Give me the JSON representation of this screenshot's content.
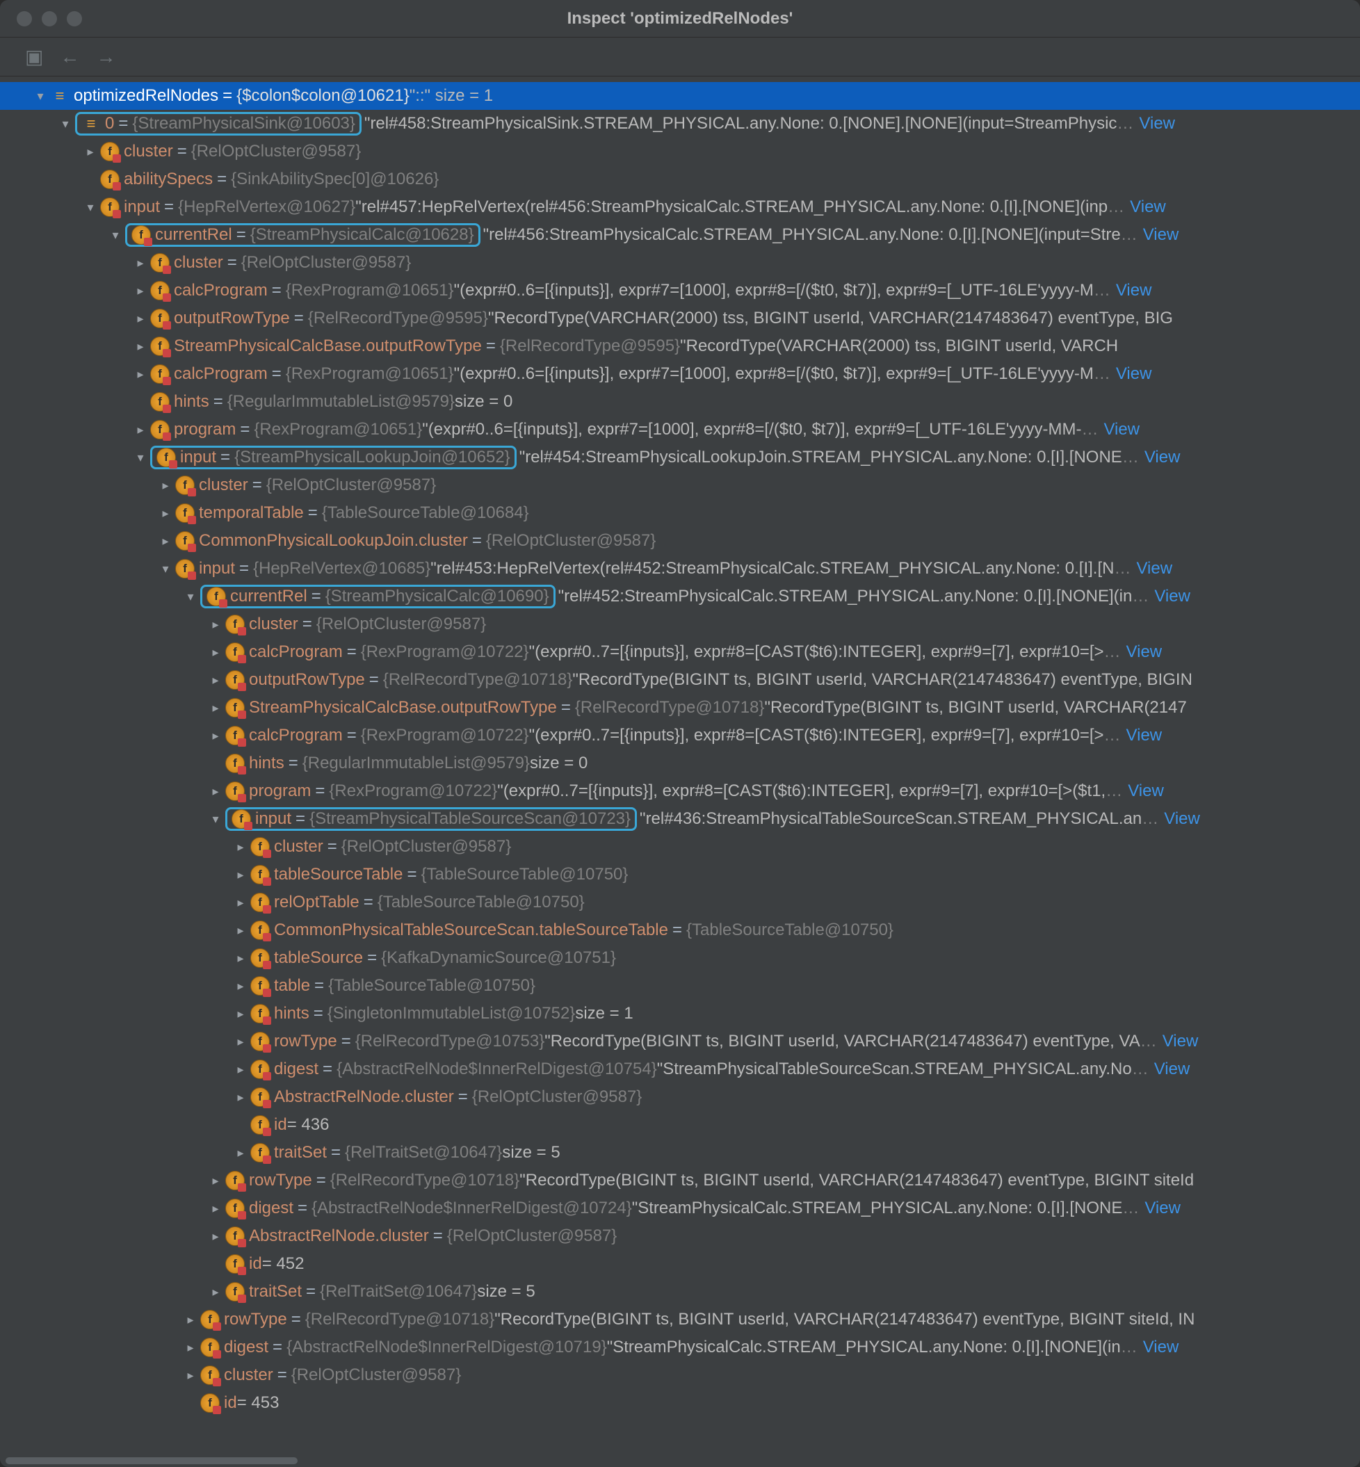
{
  "window": {
    "title": "Inspect 'optimizedRelNodes'"
  },
  "colors": {
    "highlight_box": "#3aa7d6",
    "selection": "#0d5dbb",
    "field_name": "#cf8e6d",
    "ref": "#808080",
    "link": "#3d94e8"
  },
  "actions": {
    "view": "View"
  },
  "tree": [
    {
      "depth": 0,
      "arrow": "down",
      "icon": "list",
      "sel": true,
      "name": "optimizedRelNodes",
      "ref": "{$colon$colon@10621}",
      "tail": " \"::\"  size = 1"
    },
    {
      "depth": 1,
      "arrow": "down",
      "icon": "list",
      "box": true,
      "name": "0",
      "ref": "{StreamPhysicalSink@10603}",
      "str": "\"rel#458:StreamPhysicalSink.STREAM_PHYSICAL.any.None: 0.[NONE].[NONE](input=StreamPhysic",
      "ell": true,
      "view": true
    },
    {
      "depth": 2,
      "arrow": "right",
      "icon": "f",
      "name": "cluster",
      "ref": "{RelOptCluster@9587}"
    },
    {
      "depth": 2,
      "arrow": "none",
      "icon": "f",
      "name": "abilitySpecs",
      "ref": "{SinkAbilitySpec[0]@10626}"
    },
    {
      "depth": 2,
      "arrow": "down",
      "icon": "f",
      "name": "input",
      "ref": "{HepRelVertex@10627}",
      "str": " \"rel#457:HepRelVertex(rel#456:StreamPhysicalCalc.STREAM_PHYSICAL.any.None: 0.[I].[NONE](inp",
      "ell": true,
      "view": true
    },
    {
      "depth": 3,
      "arrow": "down",
      "icon": "f",
      "box": true,
      "name": "currentRel",
      "ref": "{StreamPhysicalCalc@10628}",
      "str": "\"rel#456:StreamPhysicalCalc.STREAM_PHYSICAL.any.None: 0.[I].[NONE](input=Stre",
      "ell": true,
      "view": true
    },
    {
      "depth": 4,
      "arrow": "right",
      "icon": "f",
      "name": "cluster",
      "ref": "{RelOptCluster@9587}"
    },
    {
      "depth": 4,
      "arrow": "right",
      "icon": "f",
      "name": "calcProgram",
      "ref": "{RexProgram@10651}",
      "str": " \"(expr#0..6=[{inputs}], expr#7=[1000], expr#8=[/($t0, $t7)], expr#9=[_UTF-16LE'yyyy-M",
      "ell": true,
      "view": true
    },
    {
      "depth": 4,
      "arrow": "right",
      "icon": "f",
      "name": "outputRowType",
      "ref": "{RelRecordType@9595}",
      "str": " \"RecordType(VARCHAR(2000) tss, BIGINT userId, VARCHAR(2147483647) eventType, BIG"
    },
    {
      "depth": 4,
      "arrow": "right",
      "icon": "f",
      "name": "StreamPhysicalCalcBase.outputRowType",
      "ref": "{RelRecordType@9595}",
      "str": " \"RecordType(VARCHAR(2000) tss, BIGINT userId, VARCH"
    },
    {
      "depth": 4,
      "arrow": "right",
      "icon": "f",
      "name": "calcProgram",
      "ref": "{RexProgram@10651}",
      "str": " \"(expr#0..6=[{inputs}], expr#7=[1000], expr#8=[/($t0, $t7)], expr#9=[_UTF-16LE'yyyy-M",
      "ell": true,
      "view": true
    },
    {
      "depth": 4,
      "arrow": "none",
      "icon": "f",
      "name": "hints",
      "ref": "{RegularImmutableList@9579}",
      "tail": "  size = 0"
    },
    {
      "depth": 4,
      "arrow": "right",
      "icon": "f",
      "name": "program",
      "ref": "{RexProgram@10651}",
      "str": " \"(expr#0..6=[{inputs}], expr#7=[1000], expr#8=[/($t0, $t7)], expr#9=[_UTF-16LE'yyyy-MM-",
      "ell": true,
      "view": true
    },
    {
      "depth": 4,
      "arrow": "down",
      "icon": "f",
      "box": true,
      "name": "input",
      "ref": "{StreamPhysicalLookupJoin@10652}",
      "str": "\"rel#454:StreamPhysicalLookupJoin.STREAM_PHYSICAL.any.None: 0.[I].[NONE",
      "ell": true,
      "view": true
    },
    {
      "depth": 5,
      "arrow": "right",
      "icon": "f",
      "name": "cluster",
      "ref": "{RelOptCluster@9587}"
    },
    {
      "depth": 5,
      "arrow": "right",
      "icon": "f",
      "name": "temporalTable",
      "ref": "{TableSourceTable@10684}"
    },
    {
      "depth": 5,
      "arrow": "right",
      "icon": "f",
      "name": "CommonPhysicalLookupJoin.cluster",
      "ref": "{RelOptCluster@9587}"
    },
    {
      "depth": 5,
      "arrow": "down",
      "icon": "f",
      "name": "input",
      "ref": "{HepRelVertex@10685}",
      "str": " \"rel#453:HepRelVertex(rel#452:StreamPhysicalCalc.STREAM_PHYSICAL.any.None: 0.[I].[N",
      "ell": true,
      "view": true
    },
    {
      "depth": 6,
      "arrow": "down",
      "icon": "f",
      "box": true,
      "name": "currentRel",
      "ref": "{StreamPhysicalCalc@10690}",
      "str": "\"rel#452:StreamPhysicalCalc.STREAM_PHYSICAL.any.None: 0.[I].[NONE](in",
      "ell": true,
      "view": true
    },
    {
      "depth": 7,
      "arrow": "right",
      "icon": "f",
      "name": "cluster",
      "ref": "{RelOptCluster@9587}"
    },
    {
      "depth": 7,
      "arrow": "right",
      "icon": "f",
      "name": "calcProgram",
      "ref": "{RexProgram@10722}",
      "str": " \"(expr#0..7=[{inputs}], expr#8=[CAST($t6):INTEGER], expr#9=[7], expr#10=[>",
      "ell": true,
      "view": true
    },
    {
      "depth": 7,
      "arrow": "right",
      "icon": "f",
      "name": "outputRowType",
      "ref": "{RelRecordType@10718}",
      "str": " \"RecordType(BIGINT ts, BIGINT userId, VARCHAR(2147483647) eventType, BIGIN"
    },
    {
      "depth": 7,
      "arrow": "right",
      "icon": "f",
      "name": "StreamPhysicalCalcBase.outputRowType",
      "ref": "{RelRecordType@10718}",
      "str": " \"RecordType(BIGINT ts, BIGINT userId, VARCHAR(2147"
    },
    {
      "depth": 7,
      "arrow": "right",
      "icon": "f",
      "name": "calcProgram",
      "ref": "{RexProgram@10722}",
      "str": " \"(expr#0..7=[{inputs}], expr#8=[CAST($t6):INTEGER], expr#9=[7], expr#10=[>",
      "ell": true,
      "view": true
    },
    {
      "depth": 7,
      "arrow": "none",
      "icon": "f",
      "name": "hints",
      "ref": "{RegularImmutableList@9579}",
      "tail": "  size = 0"
    },
    {
      "depth": 7,
      "arrow": "right",
      "icon": "f",
      "name": "program",
      "ref": "{RexProgram@10722}",
      "str": " \"(expr#0..7=[{inputs}], expr#8=[CAST($t6):INTEGER], expr#9=[7], expr#10=[>($t1,",
      "ell": true,
      "view": true
    },
    {
      "depth": 7,
      "arrow": "down",
      "icon": "f",
      "box": true,
      "name": "input",
      "ref": "{StreamPhysicalTableSourceScan@10723}",
      "str": "\"rel#436:StreamPhysicalTableSourceScan.STREAM_PHYSICAL.an",
      "ell": true,
      "view": true
    },
    {
      "depth": 8,
      "arrow": "right",
      "icon": "f",
      "name": "cluster",
      "ref": "{RelOptCluster@9587}"
    },
    {
      "depth": 8,
      "arrow": "right",
      "icon": "f",
      "name": "tableSourceTable",
      "ref": "{TableSourceTable@10750}"
    },
    {
      "depth": 8,
      "arrow": "right",
      "icon": "f",
      "name": "relOptTable",
      "ref": "{TableSourceTable@10750}"
    },
    {
      "depth": 8,
      "arrow": "right",
      "icon": "f",
      "name": "CommonPhysicalTableSourceScan.tableSourceTable",
      "ref": "{TableSourceTable@10750}"
    },
    {
      "depth": 8,
      "arrow": "right",
      "icon": "f",
      "name": "tableSource",
      "ref": "{KafkaDynamicSource@10751}"
    },
    {
      "depth": 8,
      "arrow": "right",
      "icon": "f",
      "name": "table",
      "ref": "{TableSourceTable@10750}"
    },
    {
      "depth": 8,
      "arrow": "right",
      "icon": "f",
      "name": "hints",
      "ref": "{SingletonImmutableList@10752}",
      "tail": "  size = 1"
    },
    {
      "depth": 8,
      "arrow": "right",
      "icon": "f",
      "name": "rowType",
      "ref": "{RelRecordType@10753}",
      "str": " \"RecordType(BIGINT ts, BIGINT userId, VARCHAR(2147483647) eventType, VA",
      "ell": true,
      "view": true
    },
    {
      "depth": 8,
      "arrow": "right",
      "icon": "f",
      "name": "digest",
      "ref": "{AbstractRelNode$InnerRelDigest@10754}",
      "str": " \"StreamPhysicalTableSourceScan.STREAM_PHYSICAL.any.No",
      "ell": true,
      "view": true
    },
    {
      "depth": 8,
      "arrow": "right",
      "icon": "f",
      "name": "AbstractRelNode.cluster",
      "ref": "{RelOptCluster@9587}"
    },
    {
      "depth": 8,
      "arrow": "none",
      "icon": "f",
      "name": "id",
      "tail": " = 436"
    },
    {
      "depth": 8,
      "arrow": "right",
      "icon": "f",
      "name": "traitSet",
      "ref": "{RelTraitSet@10647}",
      "tail": "  size = 5"
    },
    {
      "depth": 7,
      "arrow": "right",
      "icon": "f",
      "name": "rowType",
      "ref": "{RelRecordType@10718}",
      "str": " \"RecordType(BIGINT ts, BIGINT userId, VARCHAR(2147483647) eventType, BIGINT siteId"
    },
    {
      "depth": 7,
      "arrow": "right",
      "icon": "f",
      "name": "digest",
      "ref": "{AbstractRelNode$InnerRelDigest@10724}",
      "str": " \"StreamPhysicalCalc.STREAM_PHYSICAL.any.None: 0.[I].[NONE",
      "ell": true,
      "view": true
    },
    {
      "depth": 7,
      "arrow": "right",
      "icon": "f",
      "name": "AbstractRelNode.cluster",
      "ref": "{RelOptCluster@9587}"
    },
    {
      "depth": 7,
      "arrow": "none",
      "icon": "f",
      "name": "id",
      "tail": " = 452"
    },
    {
      "depth": 7,
      "arrow": "right",
      "icon": "f",
      "name": "traitSet",
      "ref": "{RelTraitSet@10647}",
      "tail": "  size = 5"
    },
    {
      "depth": 6,
      "arrow": "right",
      "icon": "f",
      "name": "rowType",
      "ref": "{RelRecordType@10718}",
      "str": " \"RecordType(BIGINT ts, BIGINT userId, VARCHAR(2147483647) eventType, BIGINT siteId, IN"
    },
    {
      "depth": 6,
      "arrow": "right",
      "icon": "f",
      "name": "digest",
      "ref": "{AbstractRelNode$InnerRelDigest@10719}",
      "str": " \"StreamPhysicalCalc.STREAM_PHYSICAL.any.None: 0.[I].[NONE](in",
      "ell": true,
      "view": true
    },
    {
      "depth": 6,
      "arrow": "right",
      "icon": "f",
      "name": "cluster",
      "ref": "{RelOptCluster@9587}"
    },
    {
      "depth": 6,
      "arrow": "none",
      "icon": "f",
      "name": "id",
      "tail": " = 453"
    }
  ]
}
